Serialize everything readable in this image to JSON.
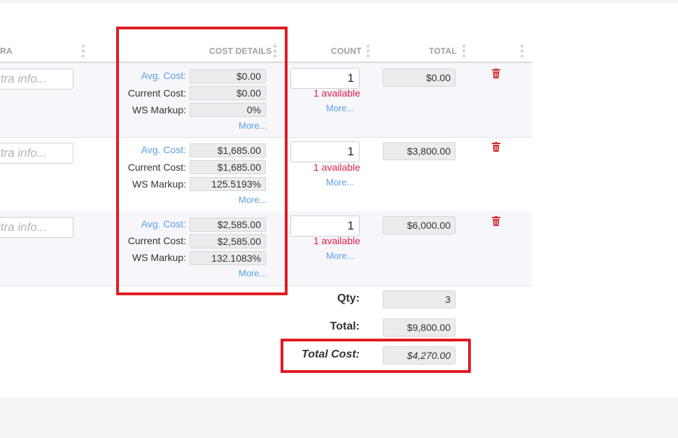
{
  "headers": {
    "extra": "RA",
    "cost_details": "COST DETAILS",
    "count": "COUNT",
    "total": "TOTAL"
  },
  "labels": {
    "avg_cost": "Avg. Cost:",
    "current_cost": "Current Cost:",
    "ws_markup": "WS Markup:",
    "more": "More...",
    "extra_placeholder": "Extra info..."
  },
  "rows": [
    {
      "avg_cost": "$0.00",
      "current_cost": "$0.00",
      "ws_markup": "0%",
      "count": "1",
      "available": "1 available",
      "total": "$0.00"
    },
    {
      "avg_cost": "$1,685.00",
      "current_cost": "$1,685.00",
      "ws_markup": "125.5193%",
      "count": "1",
      "available": "1 available",
      "total": "$3,800.00"
    },
    {
      "avg_cost": "$2,585.00",
      "current_cost": "$2,585.00",
      "ws_markup": "132.1083%",
      "count": "1",
      "available": "1 available",
      "total": "$6,000.00"
    }
  ],
  "summary": {
    "qty_label": "Qty:",
    "qty_value": "3",
    "total_label": "Total:",
    "total_value": "$9,800.00",
    "total_cost_label": "Total Cost:",
    "total_cost_value": "$4,270.00"
  },
  "icons": {
    "delete": "trash-icon",
    "column_menu": "vertical-dots-icon"
  },
  "colors": {
    "link": "#5aa0e6",
    "available": "#e0204b",
    "delete_icon": "#d32f2f",
    "highlight": "#e01b24",
    "alt_row": "#f6f6fb"
  }
}
